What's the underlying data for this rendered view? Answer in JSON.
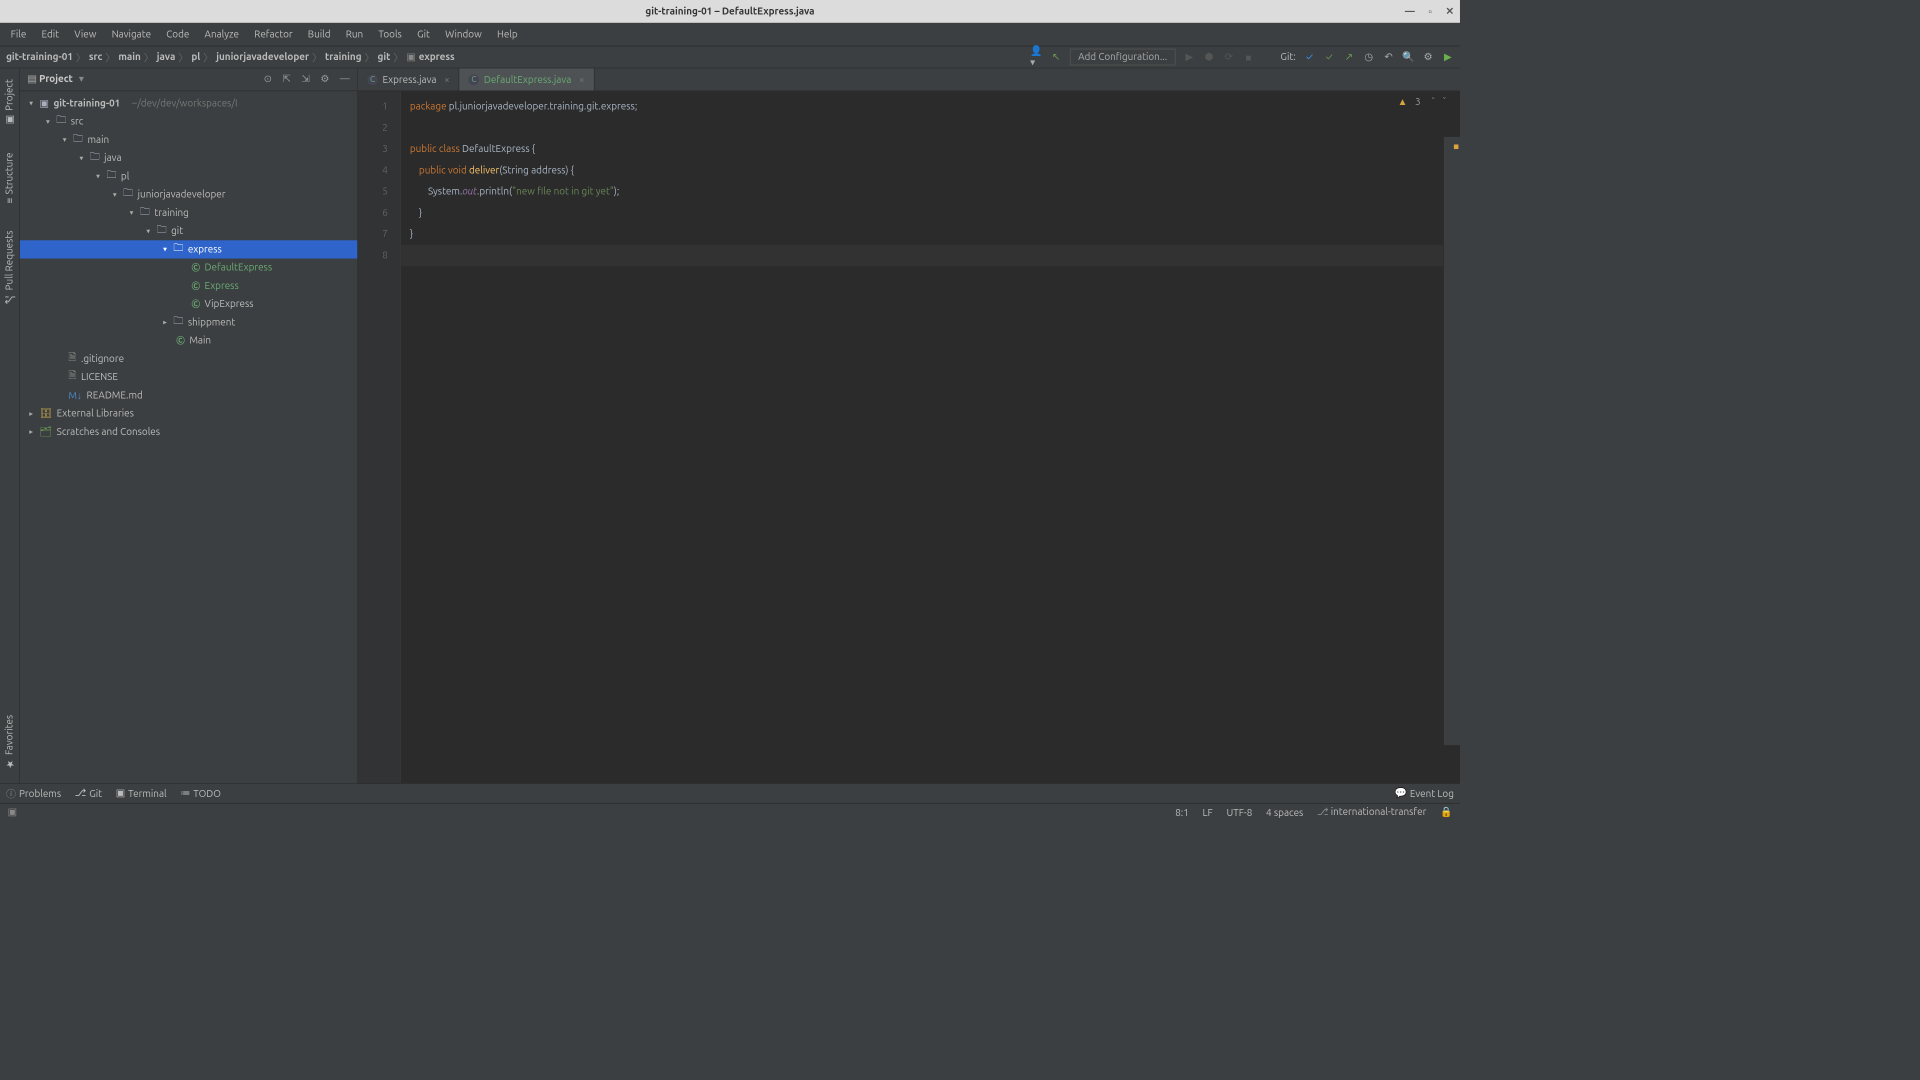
{
  "title": "git-training-01 – DefaultExpress.java",
  "menu": [
    "File",
    "Edit",
    "View",
    "Navigate",
    "Code",
    "Analyze",
    "Refactor",
    "Build",
    "Run",
    "Tools",
    "Git",
    "Window",
    "Help"
  ],
  "breadcrumb": [
    "git-training-01",
    "src",
    "main",
    "java",
    "pl",
    "juniorjavadeveloper",
    "training",
    "git",
    "express"
  ],
  "addConfig": "Add Configuration...",
  "gitLabel": "Git:",
  "projectPane": {
    "title": "Project",
    "rootName": "git-training-01",
    "rootPath": "~/dev/dev/workspaces/I",
    "nodes": {
      "src": "src",
      "main": "main",
      "java": "java",
      "pl": "pl",
      "jjd": "juniorjavadeveloper",
      "training": "training",
      "git": "git",
      "express": "express",
      "defaultExpress": "DefaultExpress",
      "express2": "Express",
      "vipExpress": "VipExpress",
      "shippment": "shippment",
      "mainClass": "Main",
      "gitignore": ".gitignore",
      "license": "LICENSE",
      "readme": "README.md",
      "extLib": "External Libraries",
      "scratches": "Scratches and Consoles"
    }
  },
  "tabs": [
    {
      "name": "Express.java",
      "active": false,
      "green": false
    },
    {
      "name": "DefaultExpress.java",
      "active": true,
      "green": true
    }
  ],
  "inspections": {
    "warning": "3"
  },
  "code": {
    "l1a": "package",
    "l1b": " pl.juniorjavadeveloper.training.git.express;",
    "l3a": "public class",
    "l3b": " DefaultExpress {",
    "l4a": "    public void ",
    "l4b": "deliver",
    "l4c": "(String address) {",
    "l5a": "        System.",
    "l5b": "out",
    "l5c": ".println(",
    "l5d": "\"new file not in git yet\"",
    "l5e": ");",
    "l6": "    }",
    "l7": "}"
  },
  "lineNumbers": [
    "1",
    "2",
    "3",
    "4",
    "5",
    "6",
    "7",
    "8"
  ],
  "leftTabs": {
    "project": "Project",
    "structure": "Structure",
    "pull": "Pull Requests",
    "fav": "Favorites"
  },
  "bottomTabs": {
    "problems": "Problems",
    "git": "Git",
    "terminal": "Terminal",
    "todo": "TODO",
    "eventlog": "Event Log"
  },
  "status": {
    "pos": "8:1",
    "eol": "LF",
    "enc": "UTF-8",
    "indent": "4 spaces",
    "branch": "international-transfer"
  }
}
